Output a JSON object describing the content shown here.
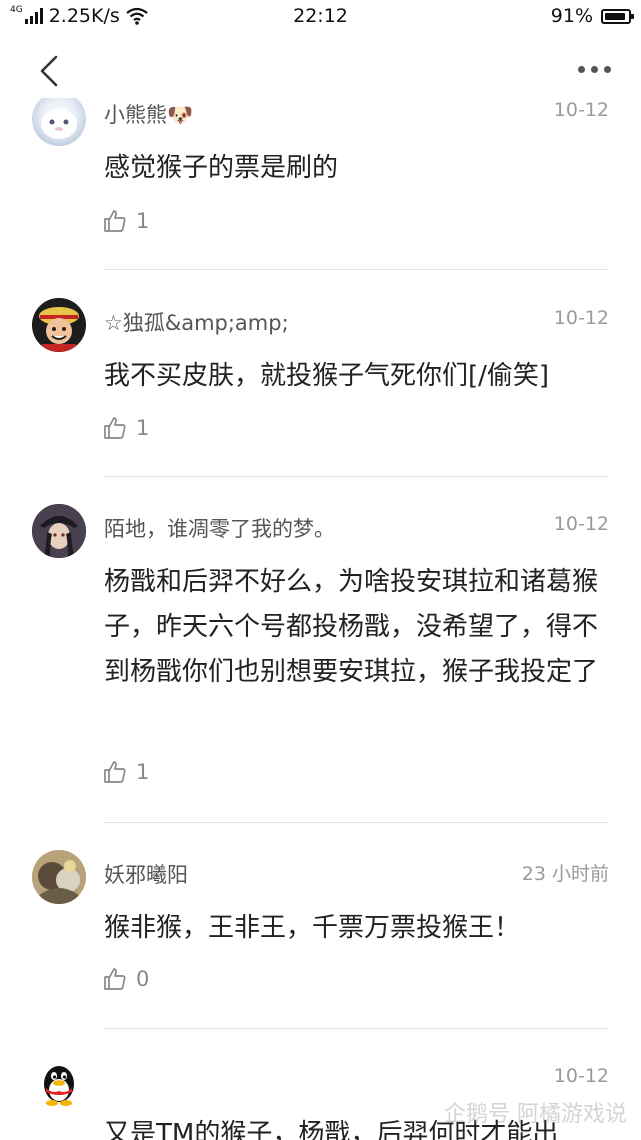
{
  "status_bar": {
    "network": "4G",
    "speed": "2.25K/s",
    "time": "22:12",
    "battery": "91%",
    "battery_level": 0.91
  },
  "comments": [
    {
      "name": "小熊熊🐶",
      "date": "10-12",
      "text": "感觉猴子的票是刷的",
      "likes": "1"
    },
    {
      "name": "☆独孤&amp;amp;",
      "date": "10-12",
      "text": "我不买皮肤，就投猴子气死你们[/偷笑]",
      "likes": "1"
    },
    {
      "name": "陌地，谁凋零了我的梦。",
      "date": "10-12",
      "text": "杨戬和后羿不好么，为啥投安琪拉和诸葛猴子，昨天六个号都投杨戬，没希望了，得不到杨戬你们也别想要安琪拉，猴子我投定了",
      "likes": "1"
    },
    {
      "name": "妖邪曦阳",
      "date": "23 小时前",
      "text": "猴非猴，王非王，千票万票投猴王！",
      "likes": "0"
    },
    {
      "name": "",
      "date": "10-12",
      "text": "又是TM的猴子，杨戬，后羿何时才能出",
      "likes": ""
    }
  ],
  "watermark": "企鹅号 阿橘游戏说"
}
